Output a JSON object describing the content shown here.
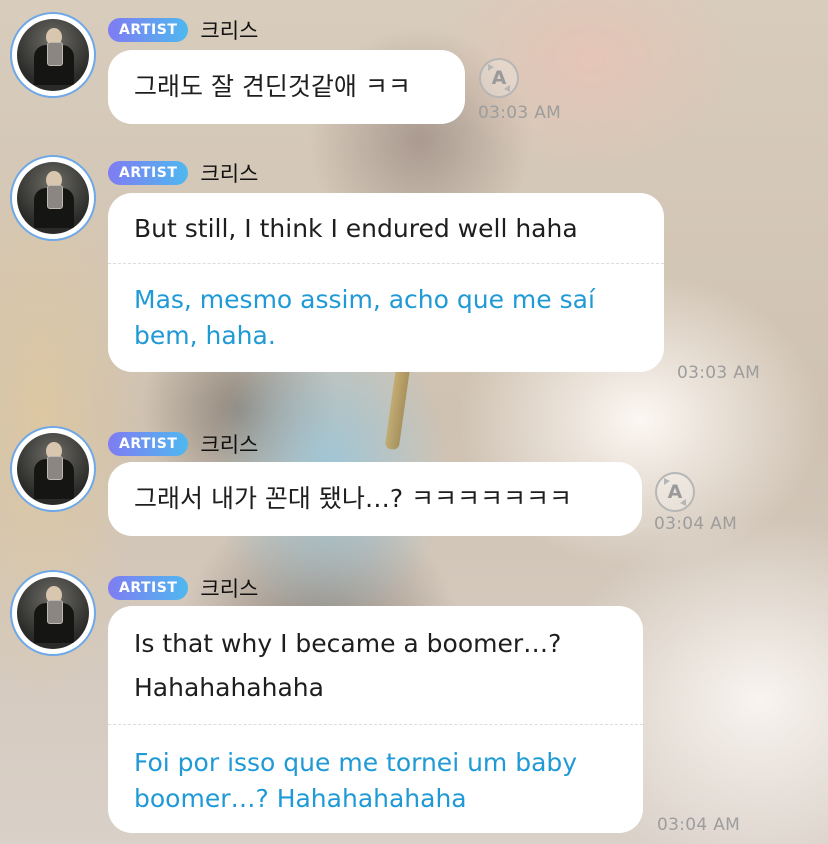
{
  "artist_badge": "ARTIST",
  "colors": {
    "badge_start": "#7f7cf2",
    "badge_end": "#4fb8ef",
    "translation_text": "#1f9ad6",
    "bubble": "#ffffff"
  },
  "messages": [
    {
      "sender": "크리스",
      "text": "그래도 잘 견딘것같애 ㅋㅋ",
      "time": "03:03 AM",
      "icon": "auto-translate-icon"
    },
    {
      "sender": "크리스",
      "text": "But still, I think I endured well haha",
      "translation": "Mas, mesmo assim, acho que me saí bem, haha.",
      "time": "03:03 AM"
    },
    {
      "sender": "크리스",
      "text": "그래서 내가 꼰대 됐나…? ㅋㅋㅋㅋㅋㅋㅋ",
      "time": "03:04 AM",
      "icon": "auto-translate-icon"
    },
    {
      "sender": "크리스",
      "text": "Is that why I became a boomer…? Hahahahahaha",
      "translation": "Foi por isso que me tornei um baby boomer…? Hahahahahaha",
      "time": "03:04 AM"
    }
  ]
}
